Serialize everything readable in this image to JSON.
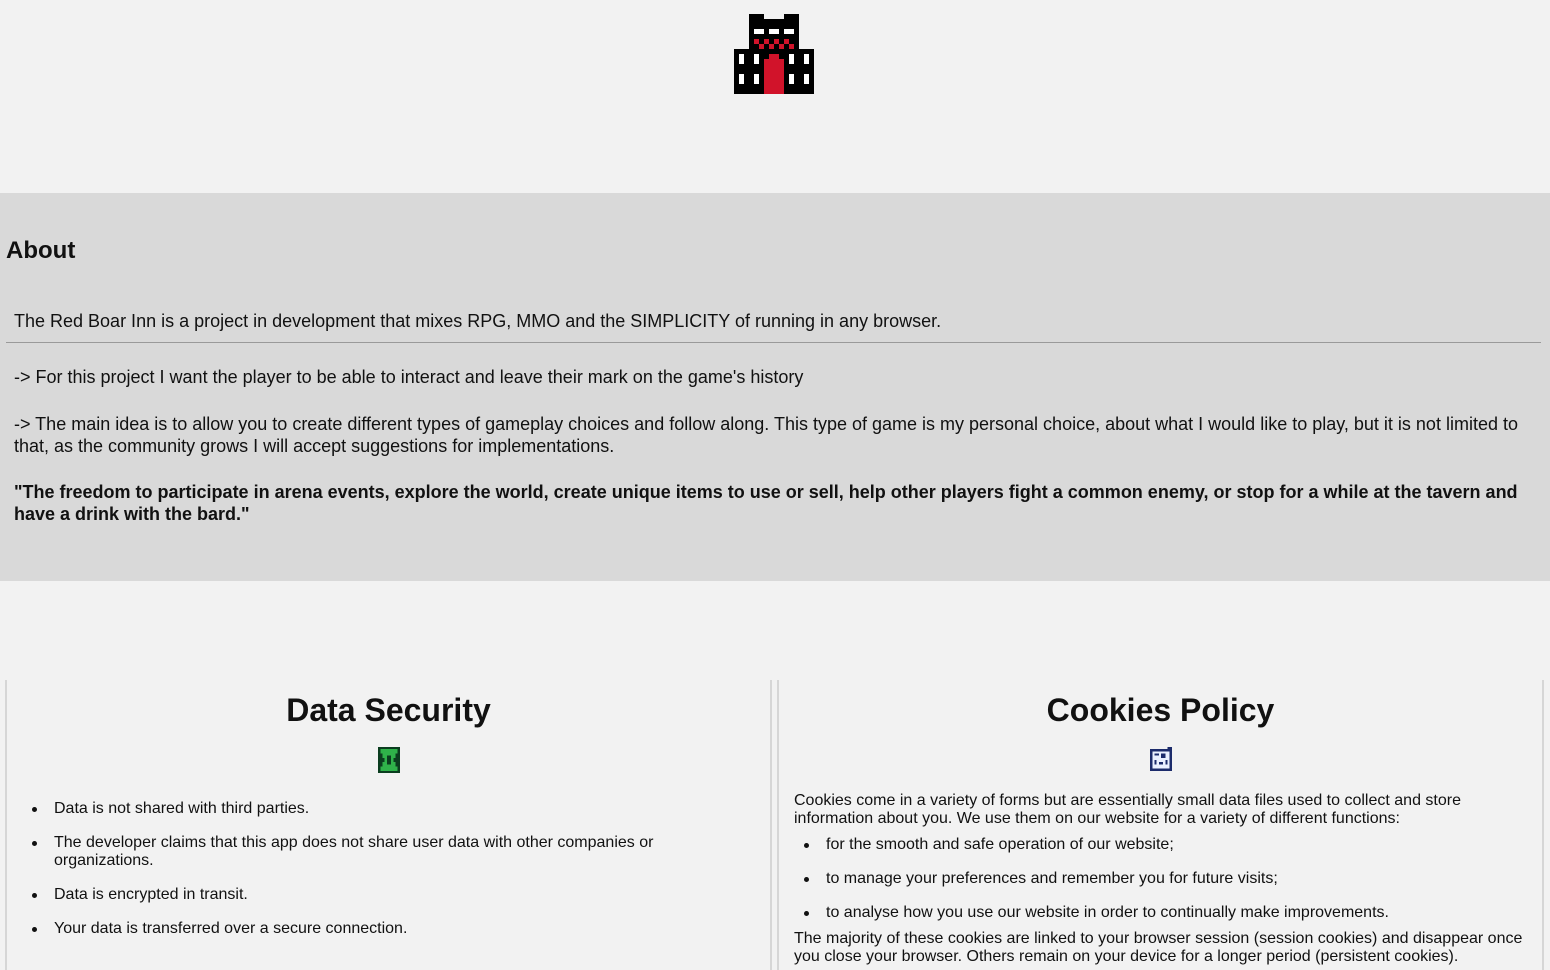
{
  "logo": {
    "icon": "inn-building-icon",
    "colors": {
      "black": "#000000",
      "white": "#ffffff",
      "red": "#d1132a"
    }
  },
  "about": {
    "title": "About",
    "intro": "The Red Boar Inn is a project in development that mixes RPG, MMO and the SIMPLICITY of running in any browser.",
    "p1": "-> For this project I want the player to be able to interact and leave their mark on the game's history",
    "p2": "-> The main idea is to allow you to create different types of gameplay choices and follow along. This type of game is my personal choice, about what I would like to play, but it is not limited to that, as the community grows I will accept suggestions for implementations.",
    "quote": "\"The freedom to participate in arena events, explore the world, create unique items to use or sell, help other players fight a common enemy, or stop for a while at the tavern and have a drink with the bard.\""
  },
  "security": {
    "title": "Data Security",
    "icon": "shield-icon",
    "items": [
      "Data is not shared with third parties.",
      "The developer claims that this app does not share user data with other companies or organizations.",
      "Data is encrypted in transit.",
      "Your data is transferred over a secure connection."
    ]
  },
  "cookies": {
    "title": "Cookies Policy",
    "icon": "cookie-icon",
    "lead": "Cookies come in a variety of forms but are essentially small data files used to collect and store information about you. We use them on our website for a variety of different functions:",
    "items": [
      "for the smooth and safe operation of our website;",
      "to manage your preferences and remember you for future visits;",
      "to analyse how you use our website in order to continually make improvements."
    ],
    "tail": "The majority of these cookies are linked to your browser session (session cookies) and disappear once you close your browser. Others remain on your device for a longer period (persistent cookies)."
  }
}
